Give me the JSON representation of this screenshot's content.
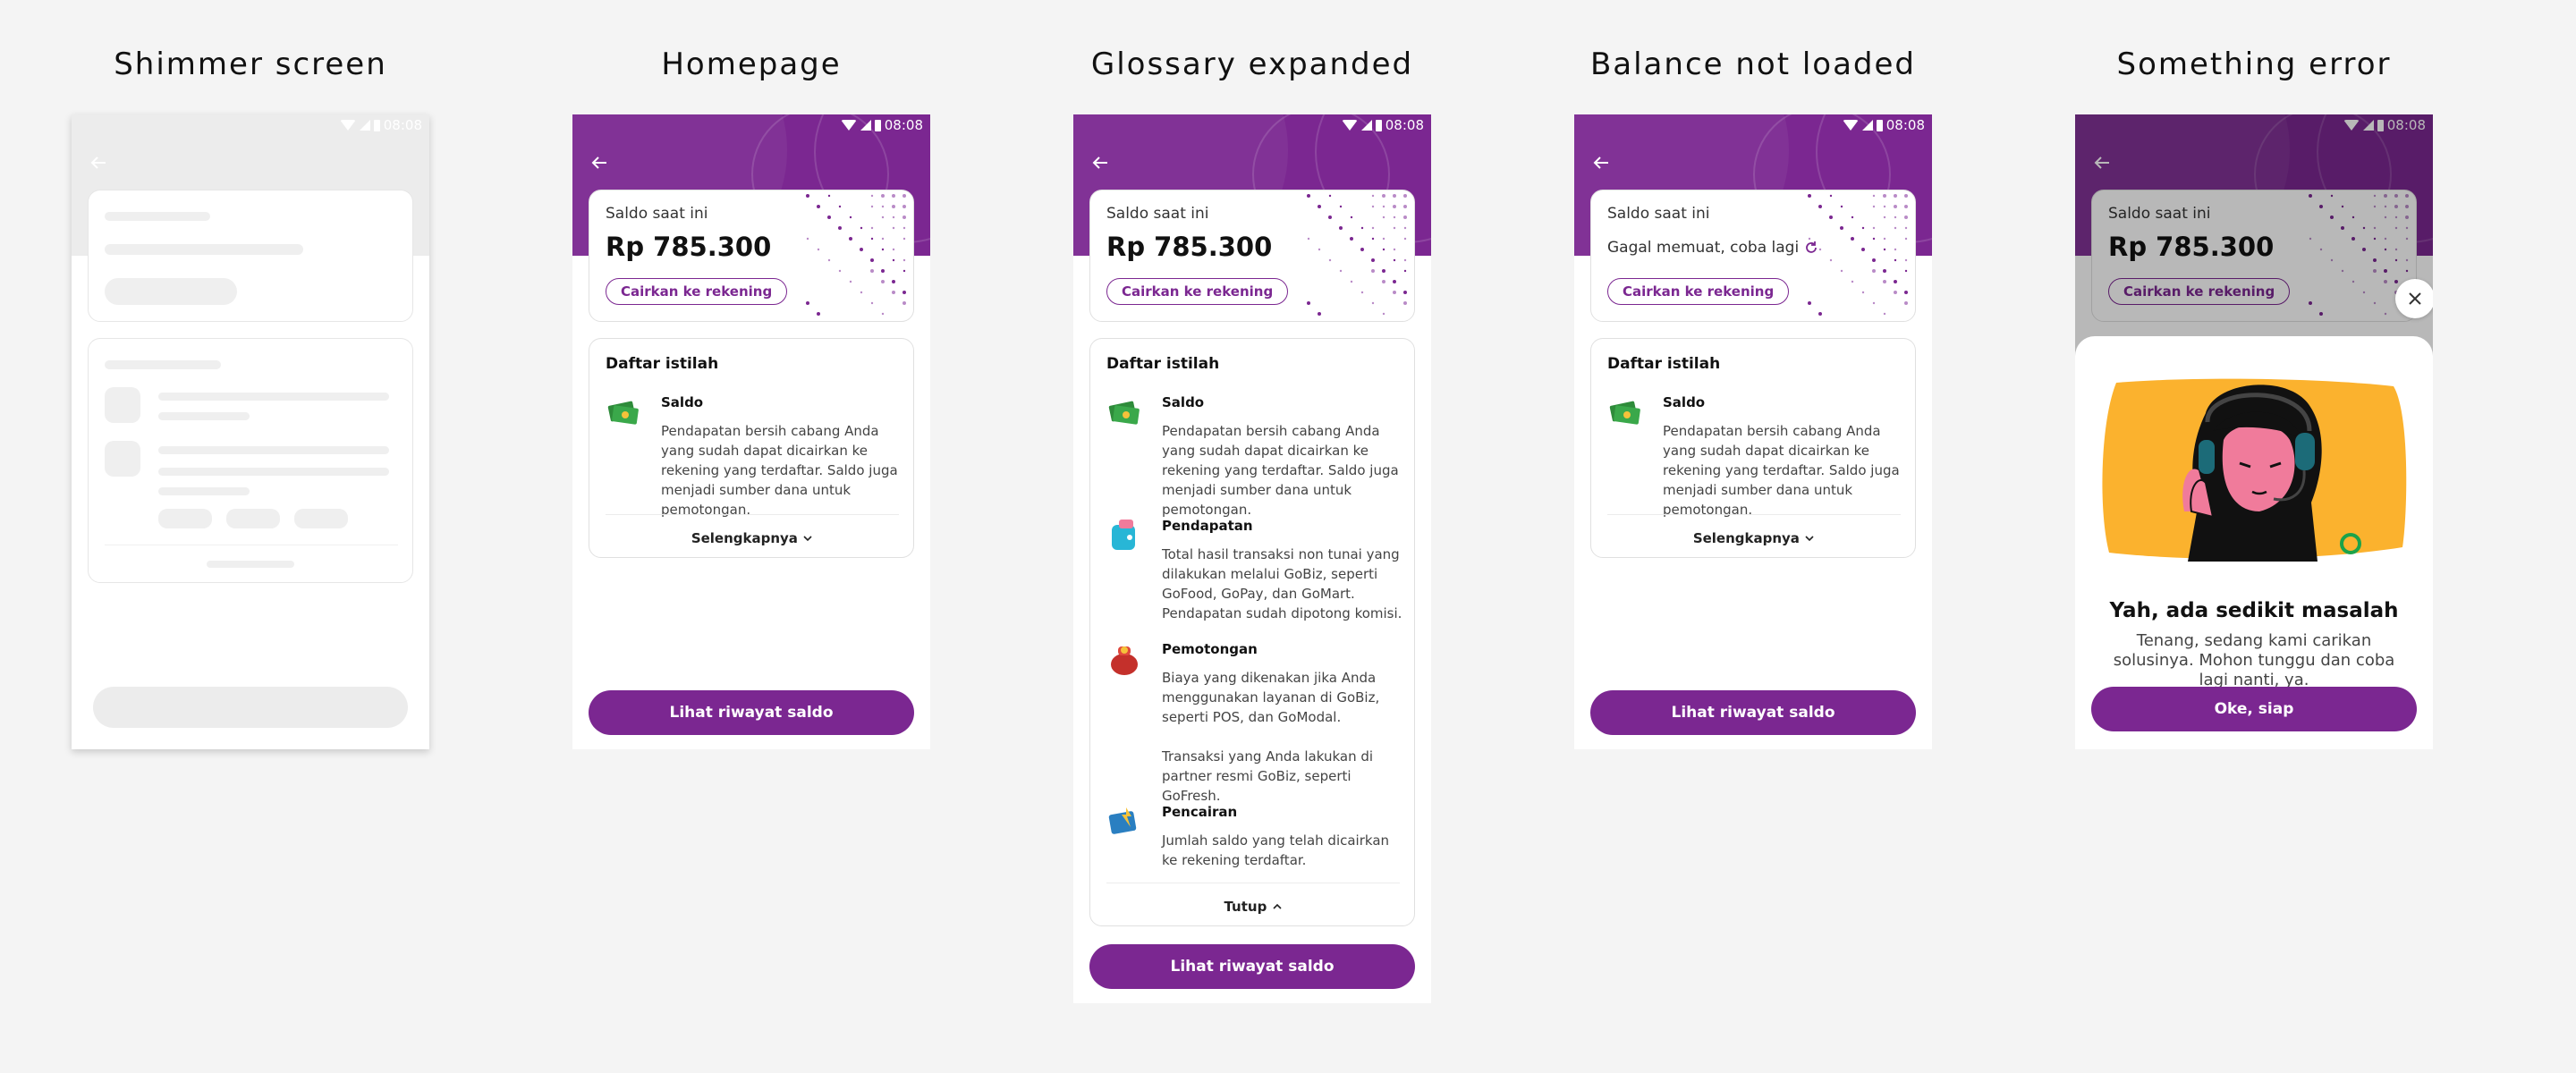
{
  "screens": {
    "shimmer": {
      "title": "Shimmer screen"
    },
    "home": {
      "title": "Homepage"
    },
    "glossary": {
      "title": "Glossary expanded"
    },
    "notloaded": {
      "title": "Balance not loaded"
    },
    "error": {
      "title": "Something error"
    }
  },
  "status_time": "08:08",
  "balance": {
    "label": "Saldo saat ini",
    "value": "Rp 785.300",
    "withdraw_label": "Cairkan ke rekening",
    "failed_text": "Gagal memuat, coba lagi"
  },
  "glossary": {
    "title": "Daftar istilah",
    "items": [
      {
        "name": "Saldo",
        "desc": "Pendapatan bersih cabang Anda yang sudah dapat dicairkan ke rekening yang terdaftar. Saldo juga menjadi sumber dana untuk pemotongan.",
        "icon": "money-icon"
      },
      {
        "name": "Pendapatan",
        "desc": "Total hasil transaksi non tunai yang dilakukan melalui GoBiz, seperti GoFood, GoPay, dan GoMart. Pendapatan sudah dipotong komisi.",
        "icon": "wallet-icon"
      },
      {
        "name": "Pemotongan",
        "desc": "Biaya yang dikenakan jika Anda menggunakan layanan di GoBiz, seperti POS, dan GoModal.\n\nTransaksi yang Anda lakukan di partner resmi GoBiz, seperti GoFresh.",
        "icon": "money-bag-icon"
      },
      {
        "name": "Pencairan",
        "desc": "Jumlah saldo yang telah dicairkan ke rekening terdaftar.",
        "icon": "transfer-card-icon"
      }
    ],
    "more_label": "Selengkapnya",
    "close_label": "Tutup"
  },
  "history_button": "Lihat riwayat saldo",
  "error": {
    "title": "Yah, ada sedikit masalah",
    "desc": "Tenang, sedang kami carikan solusinya. Mohon tunggu dan coba lagi nanti, ya.",
    "button": "Oke, siap"
  },
  "colors": {
    "brand": "#7b2791",
    "background": "#f4f4f4",
    "illustration_bg": "#fbb22e"
  }
}
